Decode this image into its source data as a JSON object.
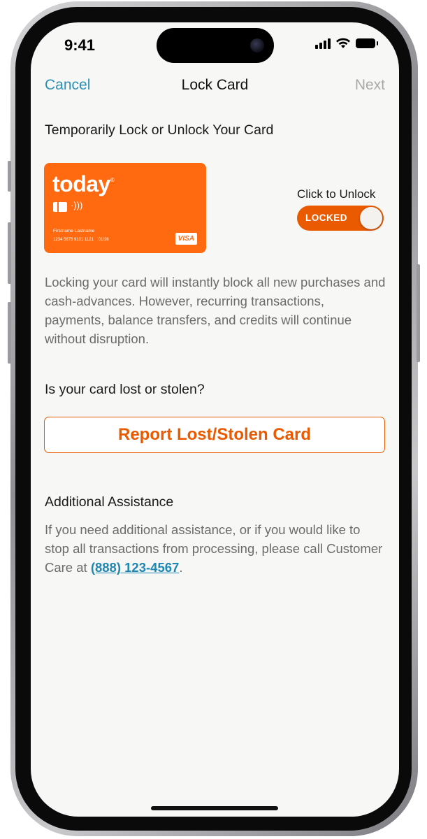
{
  "status_bar": {
    "time": "9:41"
  },
  "nav": {
    "cancel_label": "Cancel",
    "title": "Lock Card",
    "next_label": "Next"
  },
  "lock_section": {
    "heading": "Temporarily Lock or Unlock Your Card",
    "card": {
      "brand": "today",
      "brand_mark": "®",
      "cardholder": "Firstname Lastname",
      "number": "1234 5678 9101 1121",
      "expiry": "01/26",
      "network": "VISA",
      "color": "#ff6a10"
    },
    "toggle_caption": "Click to Unlock",
    "toggle_state_label": "LOCKED",
    "toggle_on": true,
    "description": "Locking your card will instantly block all new purchases and cash-advances. However, recurring transactions, payments, balance transfers, and credits will continue without disruption."
  },
  "lost_section": {
    "heading": "Is your card lost or stolen?",
    "button_label": "Report Lost/Stolen Card"
  },
  "assistance_section": {
    "heading": "Additional Assistance",
    "text_before": "If you need additional assistance, or if you would like to stop all transactions from processing, please call Customer Care at ",
    "phone": "(888) 123-4567",
    "text_after": "."
  },
  "colors": {
    "accent_orange": "#ea5a00",
    "link_blue": "#2d8fb3",
    "disabled_gray": "#a9a9a9",
    "background": "#f7f7f6"
  }
}
